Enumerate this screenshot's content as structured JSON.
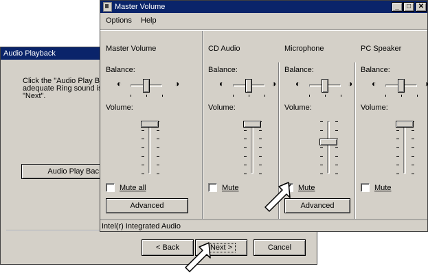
{
  "wizard": {
    "title": "Audio Playback",
    "description": "Click the \"Audio Play B\nadequate Ring sound is\n\"Next\".",
    "play_button": "Audio Play Bac",
    "back_button": "< Back",
    "next_button": "Next >",
    "cancel_button": "Cancel"
  },
  "mixer": {
    "title": "Master Volume",
    "menu": [
      "Options",
      "Help"
    ],
    "status": "Intel(r) Integrated Audio",
    "channels": [
      {
        "name": "Master Volume",
        "balance_label": "Balance:",
        "volume_label": "Volume:",
        "mute_label": "Mute all",
        "muted": false,
        "volume": 0.95,
        "balance": 0.5
      },
      {
        "name": "CD Audio",
        "balance_label": "Balance:",
        "volume_label": "Volume:",
        "mute_label": "Mute",
        "muted": false,
        "volume": 0.95,
        "balance": 0.5
      },
      {
        "name": "Microphone",
        "balance_label": "Balance:",
        "volume_label": "Volume:",
        "mute_label": "Mute",
        "muted": true,
        "volume": 0.6,
        "balance": 0.5
      },
      {
        "name": "PC Speaker",
        "balance_label": "Balance:",
        "volume_label": "Volume:",
        "mute_label": "Mute",
        "muted": false,
        "volume": 0.95,
        "balance": 0.5
      }
    ],
    "advanced_label": "Advanced"
  },
  "colors": {
    "titlebar": "#0a246a",
    "face": "#d4d0c8"
  }
}
